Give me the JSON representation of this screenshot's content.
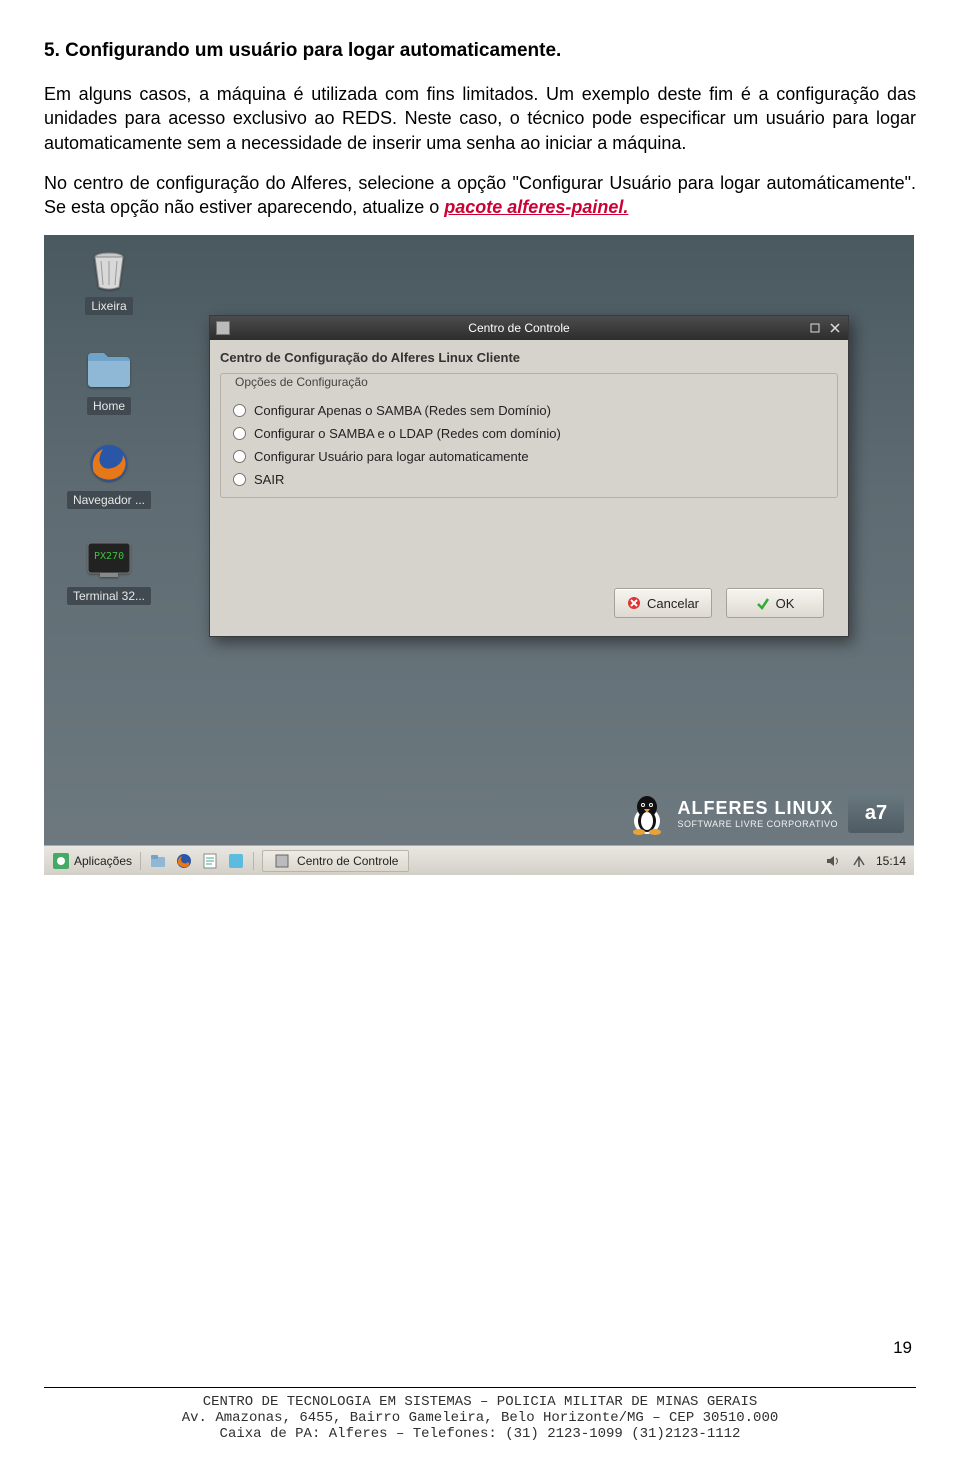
{
  "doc": {
    "heading": "5. Configurando um usuário para logar automaticamente.",
    "para1": "Em alguns casos, a máquina é utilizada com fins limitados. Um exemplo deste fim é a configuração das unidades para acesso exclusivo ao REDS. Neste caso, o técnico pode especificar um usuário para logar automaticamente sem a necessidade de inserir uma senha ao iniciar a máquina.",
    "para2a": "No centro de configuração do Alferes, selecione a opção \"Configurar Usuário para logar automáticamente\". Se esta opção não estiver aparecendo, atualize o ",
    "link_text": "pacote alferes-painel.",
    "page_number": "19"
  },
  "desktop": {
    "icons": {
      "trash": "Lixeira",
      "home": "Home",
      "browser": "Navegador ...",
      "terminal": "Terminal 32..."
    }
  },
  "window": {
    "title": "Centro de Controle",
    "section_title": "Centro de Configuração do Alferes Linux Cliente",
    "frame_title": "Opções de Configuração",
    "options": [
      "Configurar Apenas o SAMBA (Redes sem Domínio)",
      "Configurar o SAMBA e o LDAP (Redes com domínio)",
      "Configurar Usuário para logar automaticamente",
      "SAIR"
    ],
    "cancel_label": "Cancelar",
    "ok_label": "OK"
  },
  "brand": {
    "line1": "ALFERES LINUX",
    "line2": "SOFTWARE LIVRE CORPORATIVO",
    "a7": "a7"
  },
  "taskbar": {
    "menu_label": "Aplicações",
    "task_label": "Centro de Controle",
    "clock": "15:14"
  },
  "footer": {
    "l1": "CENTRO DE TECNOLOGIA EM SISTEMAS – POLICIA MILITAR DE MINAS GERAIS",
    "l2": "Av. Amazonas, 6455, Bairro Gameleira, Belo Horizonte/MG – CEP 30510.000",
    "l3": "Caixa de PA: Alferes – Telefones: (31) 2123-1099  (31)2123-1112"
  }
}
